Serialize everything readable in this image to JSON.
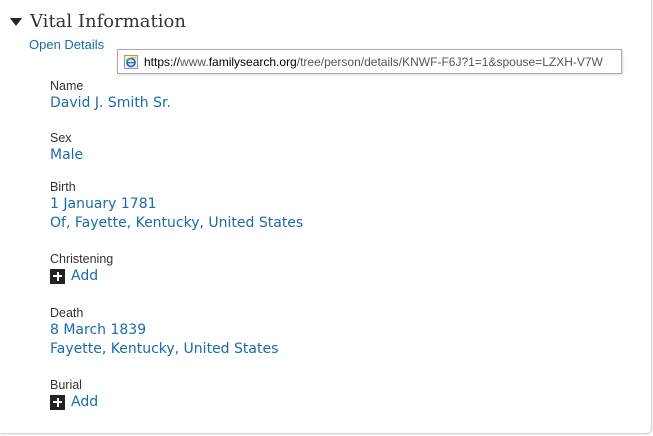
{
  "section": {
    "title": "Vital Information",
    "open_details": "Open Details"
  },
  "tooltip": {
    "url_prefix": "https://",
    "url_host_pre": "www.",
    "url_host": "familysearch.org",
    "url_rest": "/tree/person/details/KNWF-F6J?1=1&spouse=LZXH-V7W"
  },
  "fields": {
    "name": {
      "label": "Name",
      "value": "David J. Smith Sr."
    },
    "sex": {
      "label": "Sex",
      "value": "Male"
    },
    "birth": {
      "label": "Birth",
      "date": "1 January 1781",
      "place": "Of, Fayette, Kentucky, United States"
    },
    "christening": {
      "label": "Christening",
      "add": "Add"
    },
    "death": {
      "label": "Death",
      "date": "8 March 1839",
      "place": "Fayette, Kentucky, United States"
    },
    "burial": {
      "label": "Burial",
      "add": "Add"
    }
  },
  "colors": {
    "link": "#1c6aa8",
    "text": "#333333"
  },
  "icons": {
    "collapse": "triangle-down-icon",
    "add": "plus-square-icon",
    "browser": "ie-icon"
  }
}
